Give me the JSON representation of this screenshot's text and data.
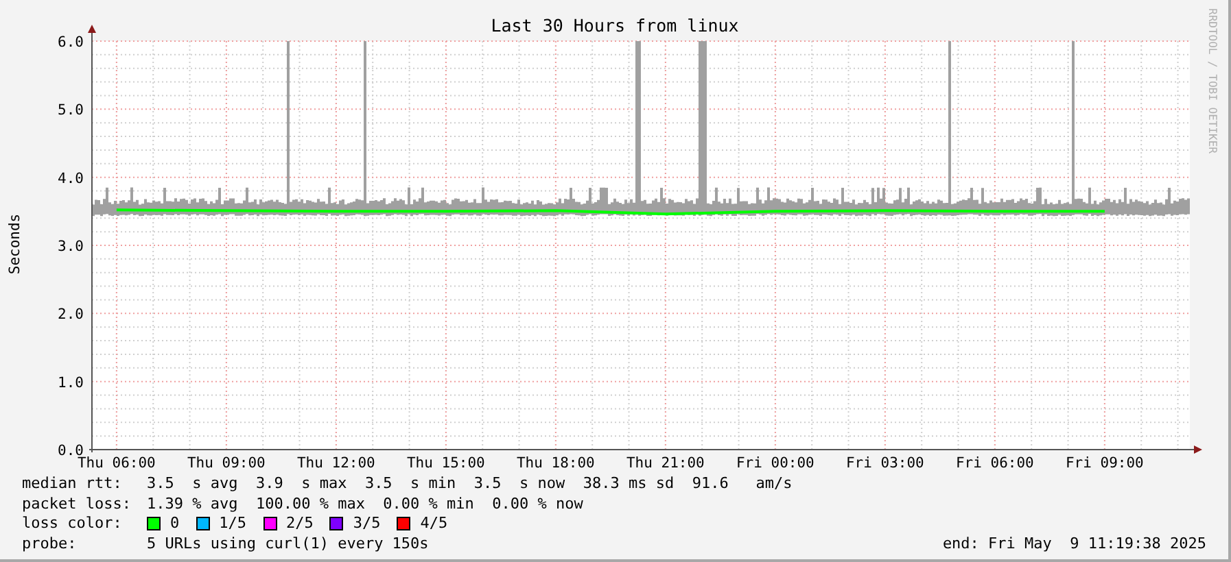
{
  "graph": {
    "title": "Last 30 Hours from linux",
    "watermark_text": "RRDTOOL / TOBI OETIKER",
    "chart_data": {
      "type": "line",
      "ylabel": "Seconds",
      "ylim": [
        0,
        6
      ],
      "categories": [
        "Thu 06:00",
        "Thu 09:00",
        "Thu 12:00",
        "Thu 15:00",
        "Thu 18:00",
        "Thu 21:00",
        "Fri 00:00",
        "Fri 03:00",
        "Fri 06:00",
        "Fri 09:00"
      ],
      "series": [
        {
          "color": "#00ff00",
          "values": [
            3.52,
            3.51,
            3.5,
            3.5,
            3.51,
            3.46,
            3.5,
            3.51,
            3.5,
            3.5
          ]
        }
      ],
      "yticks": [
        {
          "value": 0,
          "label": "0.0"
        },
        {
          "value": 1,
          "label": "1.0"
        },
        {
          "value": 2,
          "label": "2.0"
        },
        {
          "value": 3,
          "label": "3.0"
        },
        {
          "value": 4,
          "label": "4.0"
        },
        {
          "value": 5,
          "label": "5.0"
        },
        {
          "value": 6,
          "label": "6.0"
        }
      ],
      "grid": true
    }
  },
  "legend": {
    "median_rtt": {
      "label": "median rtt:",
      "values": "3.5  s avg  3.9  s max  3.5  s min  3.5  s now  38.3 ms sd  91.6   am/s"
    },
    "packet_loss": {
      "label": "packet loss:",
      "values": "1.39 % avg  100.00 % max  0.00 % min  0.00 % now"
    },
    "loss_color": {
      "label": "loss color:",
      "items": [
        {
          "label": "0",
          "color": "#00ff00"
        },
        {
          "label": "1/5",
          "color": "#00b8ff"
        },
        {
          "label": "2/5",
          "color": "#ff00ff"
        },
        {
          "label": "3/5",
          "color": "#7e00ff"
        },
        {
          "label": "4/5",
          "color": "#ff0000"
        }
      ]
    },
    "probe": {
      "label": "probe:",
      "values": "5 URLs using curl(1) every 150s"
    },
    "end": "end: Fri May  9 11:19:38 2025"
  }
}
